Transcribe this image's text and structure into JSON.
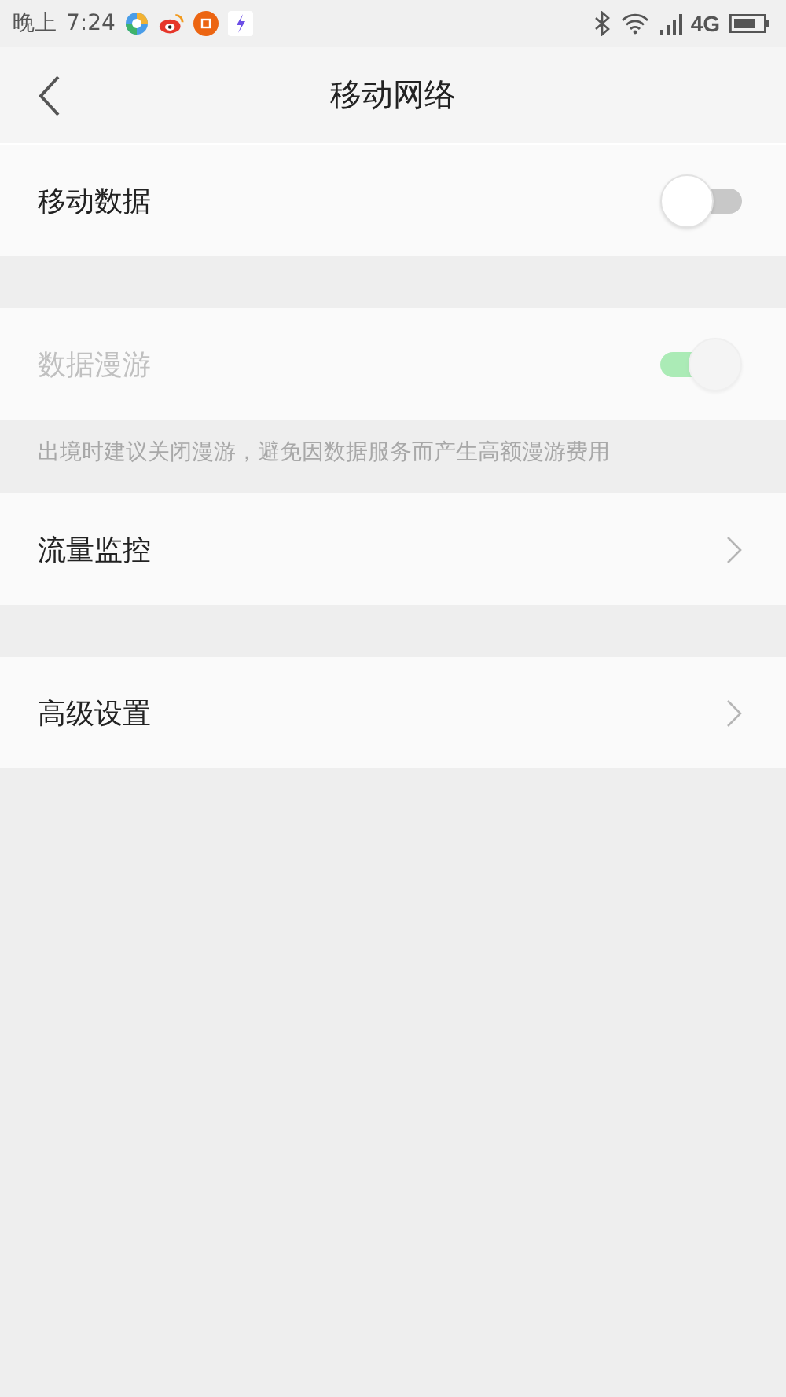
{
  "status_bar": {
    "period": "晚上",
    "time": "7:24",
    "network": "4G"
  },
  "header": {
    "title": "移动网络"
  },
  "sections": [
    {
      "items": [
        {
          "kind": "toggle",
          "label": "移动数据",
          "on": false,
          "disabled": false
        }
      ]
    },
    {
      "items": [
        {
          "kind": "toggle",
          "label": "数据漫游",
          "on": true,
          "disabled": true
        }
      ],
      "note": "出境时建议关闭漫游，避免因数据服务而产生高额漫游费用"
    },
    {
      "items": [
        {
          "kind": "link",
          "label": "流量监控"
        }
      ]
    },
    {
      "items": [
        {
          "kind": "link",
          "label": "高级设置"
        }
      ]
    }
  ]
}
